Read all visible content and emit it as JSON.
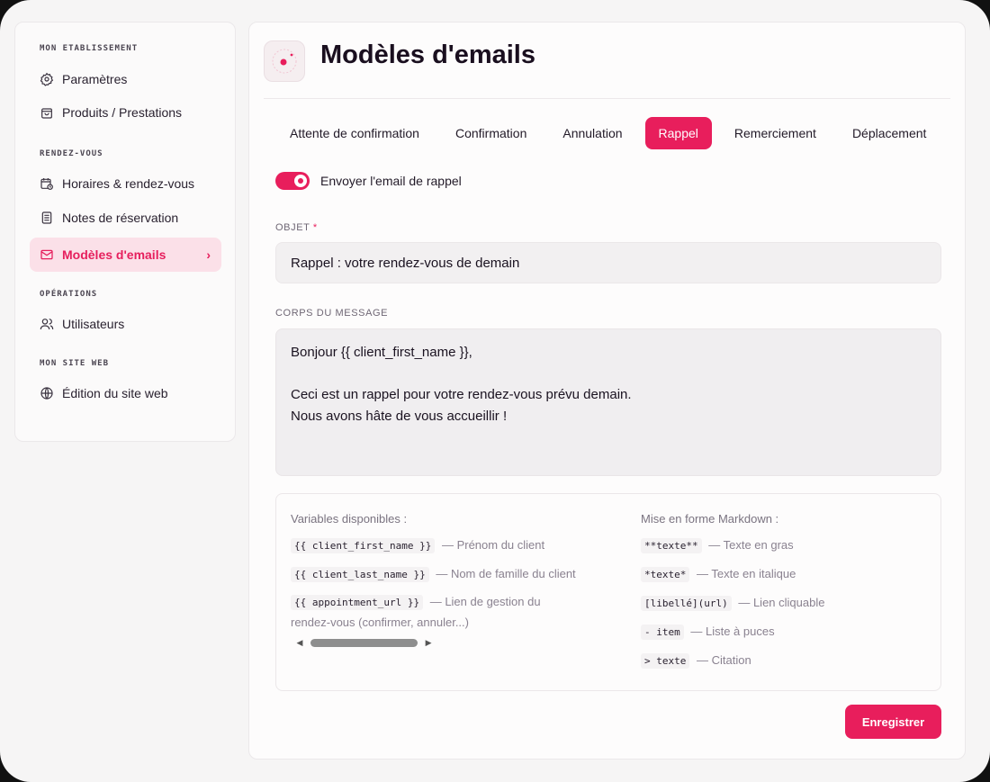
{
  "sidebar": {
    "sections": [
      {
        "title": "MON ETABLISSEMENT"
      },
      {
        "title": "RENDEZ-VOUS"
      },
      {
        "title": "OPÉRATIONS"
      },
      {
        "title": "MON SITE WEB"
      }
    ],
    "items": [
      {
        "label": "Paramètres",
        "icon": "gear-icon"
      },
      {
        "label": "Produits / Prestations",
        "icon": "bag-icon"
      },
      {
        "label": "Horaires & rendez-vous",
        "icon": "calendar-clock-icon"
      },
      {
        "label": "Notes de réservation",
        "icon": "notes-icon"
      },
      {
        "label": "Modèles d'emails",
        "icon": "mail-icon",
        "active": true
      },
      {
        "label": "Utilisateurs",
        "icon": "users-icon"
      },
      {
        "label": "Édition du site web",
        "icon": "globe-icon"
      }
    ],
    "active_chevron": "›"
  },
  "header": {
    "title": "Modèles d'emails"
  },
  "tabs": [
    {
      "label": "Attente de confirmation"
    },
    {
      "label": "Confirmation"
    },
    {
      "label": "Annulation"
    },
    {
      "label": "Rappel",
      "active": true
    },
    {
      "label": "Remerciement"
    },
    {
      "label": "Déplacement"
    }
  ],
  "toggle": {
    "label": "Envoyer l'email de rappel",
    "on": true
  },
  "subject": {
    "label": "OBJET",
    "required_mark": "*",
    "value": "Rappel : votre rendez-vous de demain"
  },
  "body": {
    "label": "CORPS DU MESSAGE",
    "lines": [
      "Bonjour {{ client_first_name }},",
      "",
      "Ceci est un rappel pour votre rendez-vous prévu demain.",
      "Nous avons hâte de vous accueillir !"
    ]
  },
  "variables": {
    "title": "Variables disponibles :",
    "rows": [
      {
        "code": "{{ client_first_name }}",
        "desc": "— Prénom du client"
      },
      {
        "code": "{{ client_last_name }}",
        "desc": "— Nom de famille du client"
      },
      {
        "code": "{{ appointment_url }}",
        "desc": "— Lien de gestion du",
        "desc_cont": "rendez-vous (confirmer, annuler...)"
      }
    ]
  },
  "markdown": {
    "title": "Mise en forme Markdown :",
    "rows": [
      {
        "code": "**texte**",
        "desc": "— Texte en gras"
      },
      {
        "code": "*texte*",
        "desc": "— Texte en italique"
      },
      {
        "code": "[libellé](url)",
        "desc": "— Lien cliquable"
      },
      {
        "code": "- item",
        "desc": "— Liste à puces"
      },
      {
        "code": "> texte",
        "desc": "— Citation"
      }
    ]
  },
  "actions": {
    "save_label": "Enregistrer"
  },
  "colors": {
    "accent": "#e81e5c",
    "active_bg": "#fbe0e8"
  }
}
